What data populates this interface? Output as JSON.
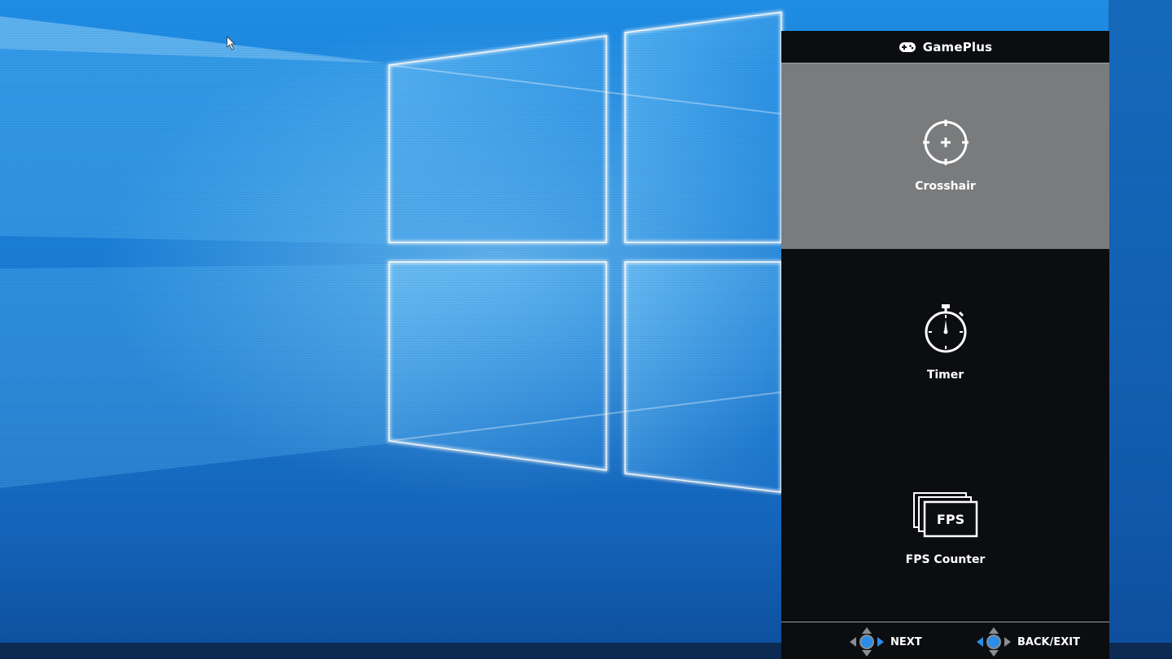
{
  "desktop": {
    "wallpaper": "windows-10-hero",
    "accent": "#1a7fd8"
  },
  "osd": {
    "title": "GamePlus",
    "title_icon": "gamepad-icon",
    "selected_index": 0,
    "items": [
      {
        "label": "Crosshair",
        "icon": "crosshair-icon"
      },
      {
        "label": "Timer",
        "icon": "stopwatch-icon"
      },
      {
        "label": "FPS Counter",
        "icon": "fps-icon",
        "icon_text": "FPS"
      }
    ],
    "footer": {
      "next_label": "NEXT",
      "back_label": "BACK/EXIT"
    },
    "colors": {
      "panel": "#0b0d10",
      "selected": "#7a7b7d",
      "joystick_center": "#2a8ee8"
    }
  }
}
